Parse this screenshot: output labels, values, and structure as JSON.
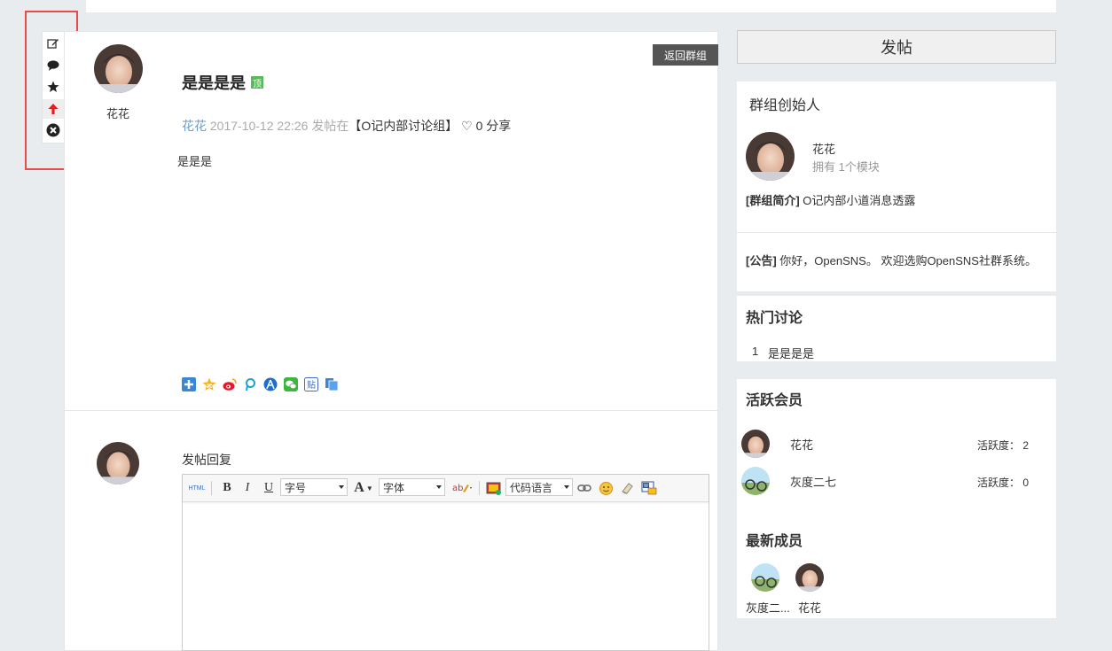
{
  "side_tools": {
    "items": [
      {
        "icon": "edit-icon"
      },
      {
        "icon": "comment-icon"
      },
      {
        "icon": "star-icon"
      },
      {
        "icon": "arrow-up-icon"
      },
      {
        "icon": "close-circle-icon"
      }
    ]
  },
  "post": {
    "back_label": "返回群组",
    "author": "花花",
    "title": "是是是是",
    "top_badge": "顶",
    "meta_author": "花花",
    "meta_time": "2017-10-12 22:26",
    "meta_posted_in": "发帖在",
    "meta_group": "【O记内部讨论组】",
    "meta_likes": "0",
    "meta_share": "分享",
    "body": "是是是",
    "share_icons": [
      "plus-share-icon",
      "qzone-icon",
      "weibo-icon",
      "tencent-icon",
      "renren-icon",
      "wechat-icon",
      "tieba-icon",
      "copy-icon"
    ]
  },
  "reply": {
    "label": "发帖回复",
    "toolbar": {
      "html": "HTML",
      "bold": "B",
      "italic": "I",
      "underline": "U",
      "font_size": "字号",
      "font_color": "A",
      "font_family": "字体",
      "code_lang": "代码语言"
    }
  },
  "sidebar": {
    "post_button": "发帖",
    "founder": {
      "title": "群组创始人",
      "name": "花花",
      "modules": "拥有 1个模块",
      "intro_label": "[群组简介]",
      "intro": "O记内部小道消息透露",
      "notice_label": "[公告]",
      "notice": "你好，OpenSNS。 欢迎选购OpenSNS社群系统。"
    },
    "hot": {
      "title": "热门讨论",
      "items": [
        {
          "rank": "1",
          "text": "是是是是"
        }
      ]
    },
    "active": {
      "title": "活跃会员",
      "members": [
        {
          "name": "花花",
          "activity": "活跃度： 2"
        },
        {
          "name": "灰度二七",
          "activity": "活跃度： 0"
        }
      ]
    },
    "newest": {
      "title": "最新成员",
      "members": [
        {
          "name": "灰度二..."
        },
        {
          "name": "花花"
        }
      ]
    }
  },
  "colors": {
    "accent_link": "#6d9cc6",
    "highlight_box": "#e84b4b",
    "top_badge": "#5cb85c"
  }
}
